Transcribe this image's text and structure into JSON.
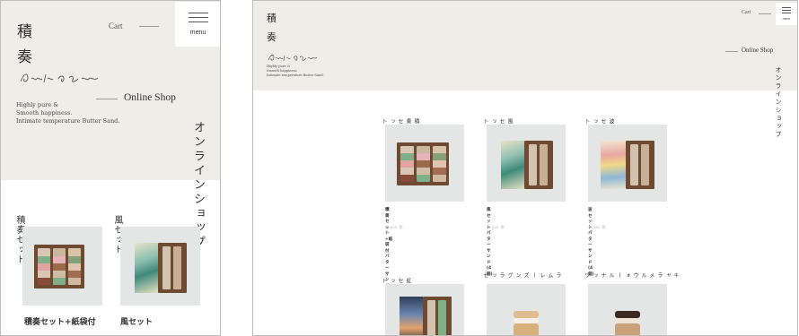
{
  "brand": {
    "char1": "積",
    "char2": "奏",
    "signature": "Gochi Sou"
  },
  "tagline": {
    "line1": "Highly pure &",
    "line2": "Smooth happiness.",
    "line3": "Intimate temperature Butter Sand."
  },
  "header": {
    "cart": "Cart",
    "menu_label": "menu",
    "section_en": "Online Shop",
    "section_jp": "オンラインショップ"
  },
  "mobile_products": [
    {
      "vertical_name": "積奏セット",
      "title_line1": "積奏セット+紙袋付"
    },
    {
      "vertical_name": "風セット",
      "title_line1": "風セット"
    }
  ],
  "products": [
    {
      "vertical_name": "積奏セット",
      "title_line1": "積奏セット+紙袋付",
      "title_line2": "バターサンド(12個)",
      "price": "¥5,820",
      "tax": "税込"
    },
    {
      "vertical_name": "風セット",
      "title_line1": "風セット",
      "title_line2": "バターサンド(4個)",
      "price": "¥1,990",
      "tax": "税込"
    },
    {
      "vertical_name": "波セット",
      "title_line1": "波セット",
      "title_line2": "バターサンド(4個)",
      "price": "¥1,990",
      "tax": "税込"
    },
    {
      "vertical_name": "虹セット"
    },
    {
      "vertical_name": "ラムレーズングラッセ"
    },
    {
      "vertical_name": "キャラメルウォールナッツ"
    }
  ],
  "colors": {
    "hero_bg": "#efede8",
    "box_brown": "#6f4a33",
    "image_bg": "#e4e6e6"
  }
}
